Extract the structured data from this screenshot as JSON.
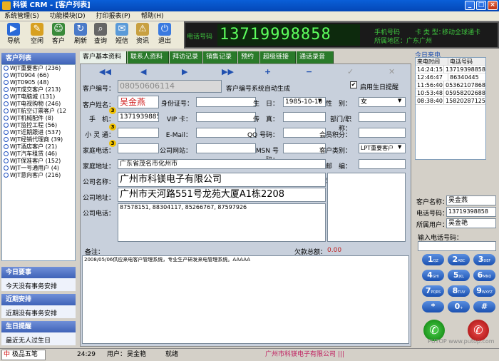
{
  "window": {
    "title": "科镁 CRM - [客户列表]"
  },
  "menu": [
    "系统管理(S)",
    "功能模块(D)",
    "打印报表(P)",
    "帮助(H)"
  ],
  "toolbar": [
    {
      "label": "导航",
      "icon": "navigation-icon"
    },
    {
      "label": "空闲",
      "icon": "idle-icon"
    },
    {
      "label": "客户",
      "icon": "customers-icon"
    },
    {
      "label": "刷新",
      "icon": "refresh-icon"
    },
    {
      "label": "查询",
      "icon": "query-icon"
    },
    {
      "label": "短信",
      "icon": "sms-icon"
    },
    {
      "label": "资讯",
      "icon": "info-icon"
    },
    {
      "label": "退出",
      "icon": "exit-icon"
    }
  ],
  "phone": {
    "label": "电话号码",
    "number": "13719998858",
    "mobile_label": "手机号码",
    "card_type_label": "卡 类 型：",
    "card_type": "移动全球通卡",
    "region_label": "所属地区：",
    "region": "广东广州"
  },
  "customer_list": {
    "title": "客户列表",
    "items": [
      "WJT重要客户 (236)",
      "WJT0904 (66)",
      "WJT0905 (48)",
      "WJT成交客户 (213)",
      "WJT电脑城 (131)",
      "WJT电视购物 (246)",
      "WJT航空订票客户 (12",
      "WJT机械配件 (8)",
      "WJT监控工程 (56)",
      "WJT近期跟进 (537)",
      "WJT经销代理商 (39)",
      "WJT酒店客户 (21)",
      "WJT汽车租赁 (46)",
      "WJT保准客户 (152)",
      "WJT一号通用户 (4)",
      "WJT意向客户 (216)"
    ]
  },
  "today": {
    "title": "今日要事",
    "text": "今天没有事务安排"
  },
  "recent": {
    "title": "近期安排",
    "text": "近期没有事务安排"
  },
  "birthday": {
    "title": "生日提醒",
    "text": "最近无人过生日"
  },
  "tabs": [
    "客户基本资料",
    "联系人资料",
    "拜访记录",
    "销售记录",
    "预约",
    "超级链接",
    "通话录音"
  ],
  "form": {
    "id_label": "客户编号：",
    "id_value": "08050606114",
    "id_note": "客户编号系统自动生成",
    "birthday_reminder": "启用生日提醒",
    "name_label": "客户姓名：",
    "name": "吴金燕",
    "idcard_label": "身份证号：",
    "birth_label": "生　日：",
    "birth": "1985-10-10",
    "sex_label": "性　别：",
    "sex": "女",
    "mobile_label": "手　机：",
    "mobile": "13719398858",
    "vip_label": "VIP 卡：",
    "fax_label": "传　真：",
    "dept_label": "部门/职称：",
    "xlt_label": "小 灵 通：",
    "email_label": "E-Mail：",
    "qq_label": "QQ 号码：",
    "points_label": "会员积分：",
    "home_label": "家庭电话：",
    "web_label": "公司网站：",
    "msn_label": "MSN 号码：",
    "type_label": "客户类别：",
    "type": "LPT重要客户",
    "home_addr_label": "家庭地址：",
    "home_addr": "广东省茂名市化州市",
    "zip_label": "邮　编：",
    "company_label": "公司名称：",
    "company": "广州市科镁电子有限公司",
    "hobby_label": "爱　好：",
    "addr_label": "公司地址：",
    "addr": "广州市天河路551号龙苑大厦A1栋2208",
    "tel_label": "公司电话：",
    "tel": "87578151, 88304117, 85266767, 87597926",
    "note_label": "备注：",
    "debt_label": "欠款总额：",
    "debt": "0.00",
    "note": "2008/05/06供应来电客户管理系统，专业生产研发来电管理系统。AAAAA"
  },
  "calls": {
    "title": "今日来电",
    "col_time": "来电时间",
    "col_num": "电话号码",
    "rows": [
      [
        "14:24:15",
        "13719398858"
      ],
      [
        "12:46:47",
        "86340445"
      ],
      [
        "11:56:40",
        "05362107868"
      ],
      [
        "10:53:48",
        "05958202688"
      ],
      [
        "08:38:40",
        "15820287125"
      ]
    ]
  },
  "caller": {
    "name_label": "客户名称：",
    "name": "吴金燕",
    "phone_label": "电话号码：",
    "phone": "13719398858",
    "user_label": "所属用户：",
    "user": "吴金艳"
  },
  "dial": {
    "label": "输入电话号码：",
    "keys": [
      [
        "1",
        "QZ"
      ],
      [
        "2",
        "ABC"
      ],
      [
        "3",
        "DEF"
      ],
      [
        "4",
        "GHI"
      ],
      [
        "5",
        "JKL"
      ],
      [
        "6",
        "MNO"
      ],
      [
        "7",
        "PQRS"
      ],
      [
        "8",
        "TUV"
      ],
      [
        "9",
        "WXYZ"
      ],
      [
        "*",
        ""
      ],
      [
        "0",
        "+"
      ],
      [
        "#",
        ""
      ]
    ]
  },
  "status": {
    "ime": "极品五笔",
    "time": "24:29",
    "user_label": "用户：",
    "user": "吴金艳",
    "state": "就绪",
    "company": "广州市科镁电子有限公司 |||"
  },
  "watermark": "PUTOP www.putop.com"
}
